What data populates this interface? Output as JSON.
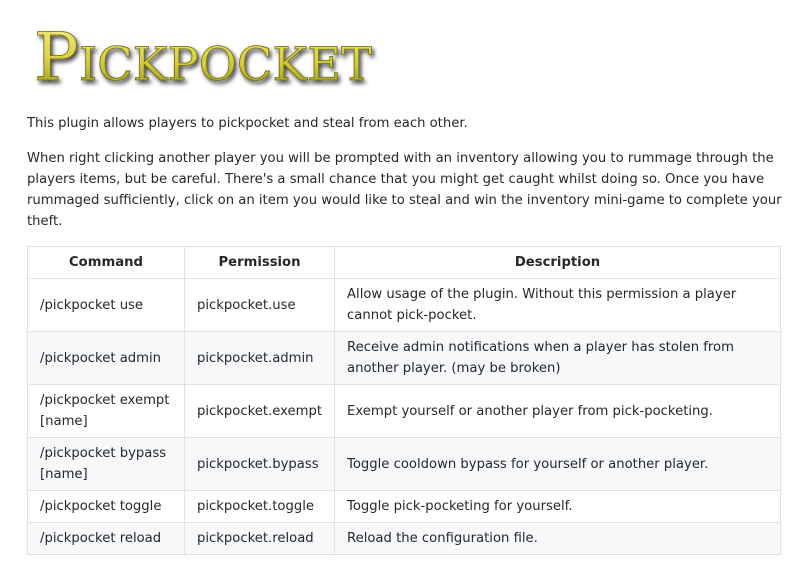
{
  "logo": {
    "text": "Pickpocket"
  },
  "intro": "This plugin allows players to pickpocket and steal from each other.",
  "details": "When right clicking another player you will be prompted with an inventory allowing you to rummage through the players items, but be careful. There's a small chance that you might get caught whilst doing so. Once you have rummaged sufficiently, click on an item you would like to steal and win the inventory mini-game to complete your theft.",
  "table": {
    "headers": [
      "Command",
      "Permission",
      "Description"
    ],
    "rows": [
      {
        "command": "/pickpocket use",
        "permission": "pickpocket.use",
        "description": "Allow usage of the plugin. Without this permission a player cannot pick-pocket."
      },
      {
        "command": "/pickpocket admin",
        "permission": "pickpocket.admin",
        "description": "Receive admin notifications when a player has stolen from another player. (may be broken)"
      },
      {
        "command": "/pickpocket exempt [name]",
        "permission": "pickpocket.exempt",
        "description": "Exempt yourself or another player from pick-pocketing."
      },
      {
        "command": "/pickpocket bypass [name]",
        "permission": "pickpocket.bypass",
        "description": "Toggle cooldown bypass for yourself or another player."
      },
      {
        "command": "/pickpocket toggle",
        "permission": "pickpocket.toggle",
        "description": "Toggle pick-pocketing for yourself."
      },
      {
        "command": "/pickpocket reload",
        "permission": "pickpocket.reload",
        "description": "Reload the configuration file."
      }
    ]
  },
  "colors": {
    "logo_fill_top": "#f3ec7a",
    "logo_fill_bottom": "#9c9a1e",
    "logo_shadow": "#555555",
    "border": "#dfe2e5",
    "stripe": "#f6f8fa"
  }
}
